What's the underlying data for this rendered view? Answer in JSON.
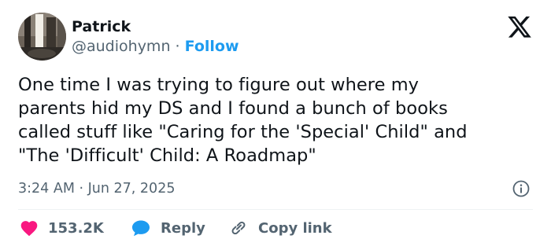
{
  "author": {
    "name": "Patrick",
    "handle": "@audiohymn",
    "separator": "·",
    "follow_label": "Follow"
  },
  "tweet": {
    "lines": [
      "One time I was trying to figure out where my",
      "parents hid my DS and I found a bunch of books",
      "called stuff like \"Caring for the 'Special' Child\" and",
      "\"The 'Difficult' Child: A Roadmap\""
    ],
    "timestamp": "3:24 AM · Jun 27, 2025"
  },
  "actions": {
    "like_count": "153.2K",
    "reply_label": "Reply",
    "copy_label": "Copy link"
  },
  "icons": {
    "logo": "x-logo-icon",
    "info": "info-icon",
    "like": "heart-icon",
    "reply": "speech-bubble-icon",
    "copy": "link-icon"
  },
  "colors": {
    "text": "#0f1419",
    "muted": "#536471",
    "accent": "#1d9bf0",
    "heart": "#f91880"
  }
}
